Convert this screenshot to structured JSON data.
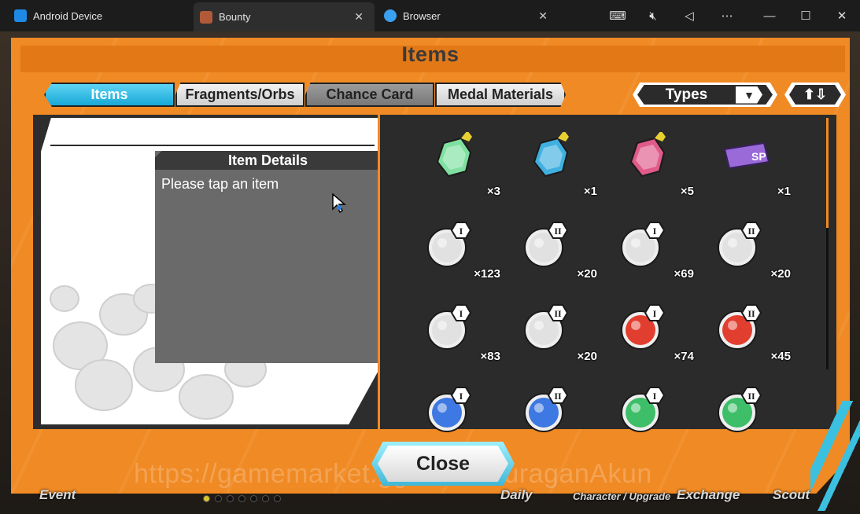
{
  "window": {
    "tabs": [
      {
        "label": "Android Device",
        "icon": "app-icon"
      },
      {
        "label": "Bounty",
        "icon": "game-icon"
      },
      {
        "label": "Browser",
        "icon": "browser-icon"
      }
    ],
    "controls": [
      "keyboard-icon",
      "mute-icon",
      "back-icon",
      "more-icon",
      "minimize-icon",
      "maximize-icon",
      "close-window-icon"
    ]
  },
  "screen": {
    "title": "Items",
    "tabs": [
      "Items",
      "Fragments/Orbs",
      "Chance Card",
      "Medal Materials"
    ],
    "active_tab": "Items",
    "types_label": "Types",
    "details": {
      "heading": "Item Details",
      "prompt": "Please tap an item"
    },
    "items": [
      {
        "name": "100-medal",
        "count": "×3",
        "color": "#7fe0a0"
      },
      {
        "name": "blue-medal",
        "count": "×1",
        "color": "#3fb0e0"
      },
      {
        "name": "pink-medal",
        "count": "×5",
        "color": "#e05a8a"
      },
      {
        "name": "sp-ticket",
        "count": "×1",
        "color": "#9a6ad8"
      },
      {
        "name": "silver-orb-fist-1",
        "count": "×123",
        "roman": "I"
      },
      {
        "name": "silver-orb-fist-2",
        "count": "×20",
        "roman": "II"
      },
      {
        "name": "silver-orb-shield-1",
        "count": "×69",
        "roman": "I"
      },
      {
        "name": "silver-orb-shield-2",
        "count": "×20",
        "roman": "II"
      },
      {
        "name": "silver-orb-boot-1",
        "count": "×83",
        "roman": "I"
      },
      {
        "name": "silver-orb-boot-2",
        "count": "×20",
        "roman": "II"
      },
      {
        "name": "red-orb-1",
        "count": "×74",
        "roman": "I",
        "color": "#e02a1a"
      },
      {
        "name": "red-orb-2",
        "count": "×45",
        "roman": "II",
        "color": "#e02a1a"
      },
      {
        "name": "blue-orb-1",
        "count": "",
        "roman": "I",
        "color": "#2a6ae0"
      },
      {
        "name": "blue-orb-2",
        "count": "",
        "roman": "II",
        "color": "#2a6ae0"
      },
      {
        "name": "green-orb-1",
        "count": "",
        "roman": "I",
        "color": "#2ab85a"
      },
      {
        "name": "green-orb-2",
        "count": "",
        "roman": "II",
        "color": "#2ab85a"
      }
    ],
    "close_label": "Close",
    "watermark": "https://gamemarket.gg/seller/JuraganAkun",
    "bottom_nav": [
      "Event",
      "Daily",
      "Character / Upgrade",
      "Exchange",
      "Scout"
    ]
  },
  "colors": {
    "panel": "#f08a24",
    "accent": "#18a8d8",
    "dark": "#2b2b2b"
  }
}
